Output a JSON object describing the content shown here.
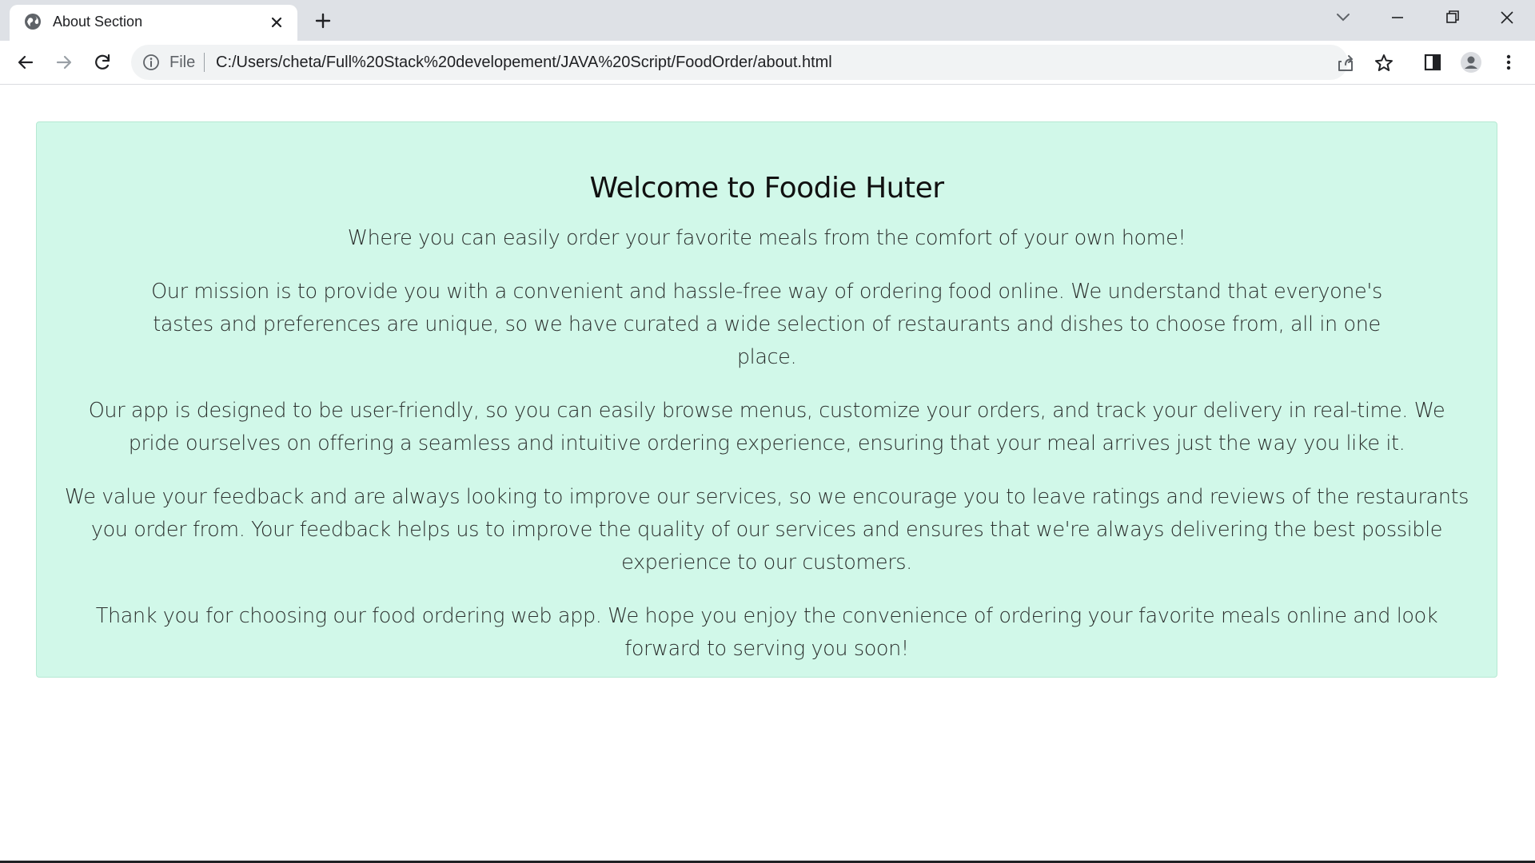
{
  "browser": {
    "tab": {
      "title": "About Section",
      "favicon": "globe-icon"
    },
    "address": {
      "scheme_label": "File",
      "url": "C:/Users/cheta/Full%20Stack%20developement/JAVA%20Script/FoodOrder/about.html"
    },
    "icons": {
      "back": "back-arrow-icon",
      "forward": "forward-arrow-icon",
      "reload": "reload-icon",
      "info": "info-icon",
      "share": "share-icon",
      "bookmark": "star-icon",
      "side_panel": "side-panel-icon",
      "profile": "profile-icon",
      "menu": "more-vert-icon",
      "tab_search": "chevron-down-icon",
      "minimize": "minimize-icon",
      "restore": "restore-icon",
      "close": "close-icon",
      "new_tab": "plus-icon"
    }
  },
  "page": {
    "heading": "Welcome to Foodie Huter",
    "paragraphs": {
      "intro": "Where you can easily order your favorite meals from the comfort of your own home!",
      "mission": "Our mission is to provide you with a convenient and hassle-free way of ordering food online. We understand that everyone's tastes and preferences are unique, so we have curated a wide selection of restaurants and dishes to choose from, all in one place.",
      "app": "Our app is designed to be user-friendly, so you can easily browse menus, customize your orders, and track your delivery in real-time. We pride ourselves on offering a seamless and intuitive ordering experience, ensuring that your meal arrives just the way you like it.",
      "feedback": "We value your feedback and are always looking to improve our services, so we encourage you to leave ratings and reviews of the restaurants you order from. Your feedback helps us to improve the quality of our services and ensures that we're always delivering the best possible experience to our customers.",
      "thanks": "Thank you for choosing our food ordering web app. We hope you enjoy the convenience of ordering your favorite meals online and look forward to serving you soon!"
    }
  },
  "colors": {
    "card_background": "#d1f8e9",
    "tabstrip_background": "#dee1e6",
    "omnibox_background": "#f1f3f4"
  }
}
